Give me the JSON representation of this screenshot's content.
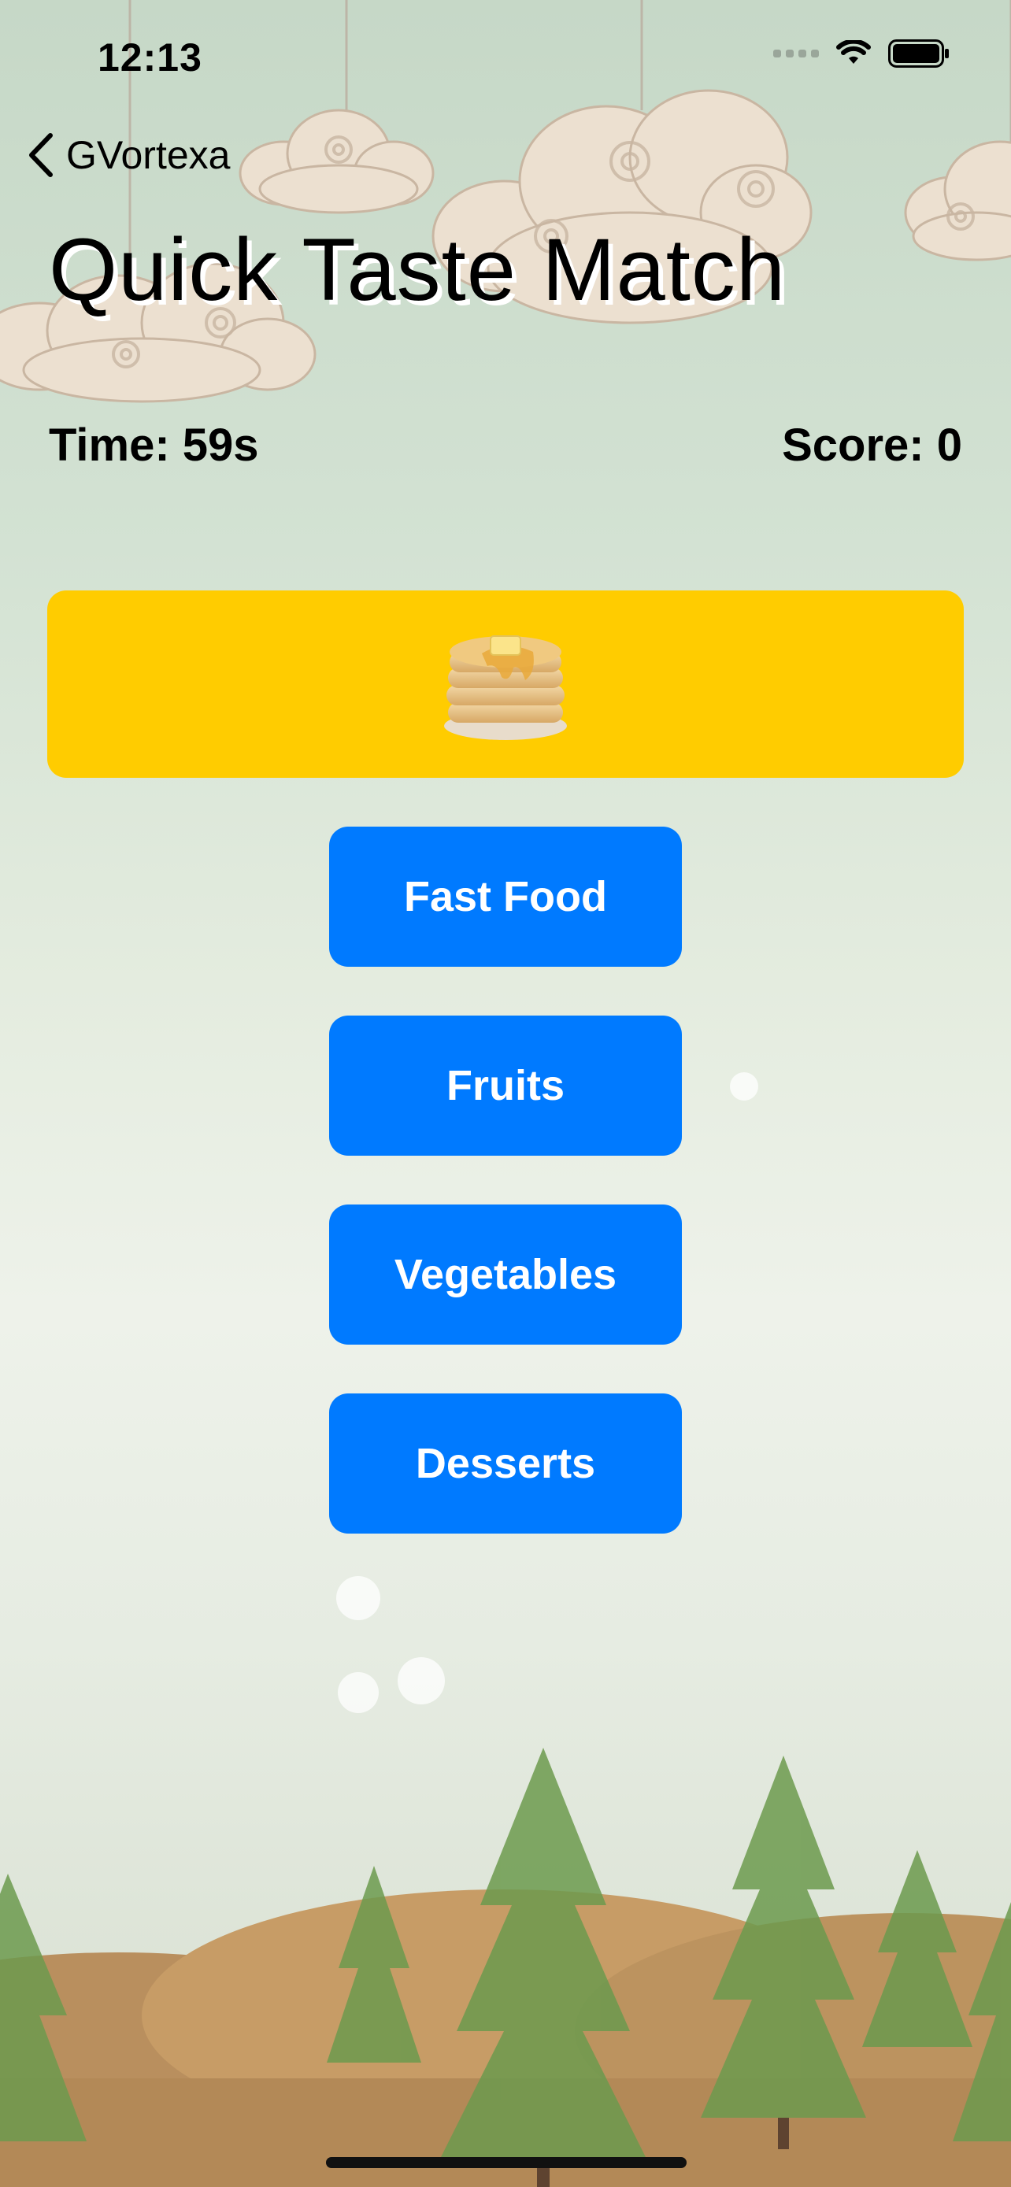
{
  "status_bar": {
    "time": "12:13",
    "icons": [
      "cellular-signal-icon",
      "wifi-icon",
      "battery-icon"
    ]
  },
  "nav": {
    "back_label": "GVortexa",
    "back_icon": "chevron-left-icon"
  },
  "title": "Quick Taste Match",
  "stats": {
    "time": "Time: 59s",
    "score": "Score: 0"
  },
  "prompt": {
    "emoji": "🥞",
    "icon": "pancakes-icon",
    "background_color": "#ffcc00"
  },
  "choices": [
    {
      "label": "Fast Food"
    },
    {
      "label": "Fruits"
    },
    {
      "label": "Vegetables"
    },
    {
      "label": "Desserts"
    }
  ],
  "colors": {
    "accent": "#007aff",
    "prompt_bg": "#ffcc00",
    "background": "#dfe8dc"
  }
}
